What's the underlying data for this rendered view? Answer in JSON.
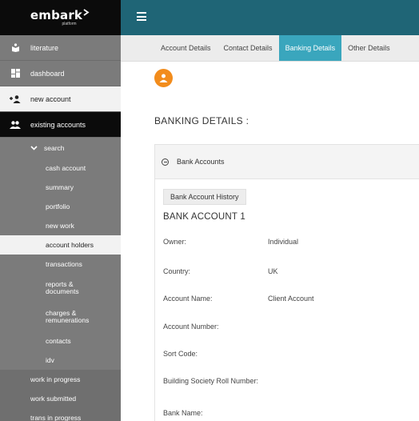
{
  "brand": {
    "name": "embark",
    "tagline": "platform"
  },
  "sidebar": {
    "top_items": [
      {
        "label": "literature",
        "icon": "literature-icon"
      },
      {
        "label": "dashboard",
        "icon": "dashboard-icon"
      },
      {
        "label": "new account",
        "icon": "add-user-icon"
      },
      {
        "label": "existing accounts",
        "icon": "users-icon"
      }
    ],
    "search": {
      "label": "search",
      "icon": "chevron-down-icon"
    },
    "sub_items": [
      {
        "label": "cash account"
      },
      {
        "label": "summary"
      },
      {
        "label": "portfolio"
      },
      {
        "label": "new work"
      },
      {
        "label": "account holders"
      },
      {
        "label": "transactions"
      },
      {
        "label": "reports & documents"
      },
      {
        "label": "charges & remunerations"
      },
      {
        "label": "contacts"
      },
      {
        "label": "idv"
      }
    ],
    "bottom_items": [
      {
        "label": "work in progress"
      },
      {
        "label": "work submitted"
      },
      {
        "label": "trans in progress"
      }
    ]
  },
  "tabs": [
    {
      "label": "Account Details"
    },
    {
      "label": "Contact Details"
    },
    {
      "label": "Banking Details",
      "active": true
    },
    {
      "label": "Other Details"
    }
  ],
  "main": {
    "title": "BANKING DETAILS :",
    "panel": {
      "heading": "Bank Accounts",
      "history_button": "Bank Account History",
      "account_title": "BANK ACCOUNT 1",
      "fields": [
        {
          "label": "Owner:",
          "value": "Individual"
        },
        {
          "label": "Country:",
          "value": "UK"
        },
        {
          "label": "Account Name:",
          "value": "Client Account"
        },
        {
          "label": "Account Number:",
          "value": ""
        },
        {
          "label": "Sort Code:",
          "value": ""
        },
        {
          "label": "Building Society Roll Number:",
          "value": ""
        },
        {
          "label": "Bank Name:",
          "value": ""
        }
      ]
    }
  },
  "colors": {
    "header": "#1f6576",
    "active_tab": "#3aa6bd",
    "sidebar": "#7b7b7b",
    "sidebar_dark": "#0b0b0b",
    "avatar": "#f28c1c"
  }
}
